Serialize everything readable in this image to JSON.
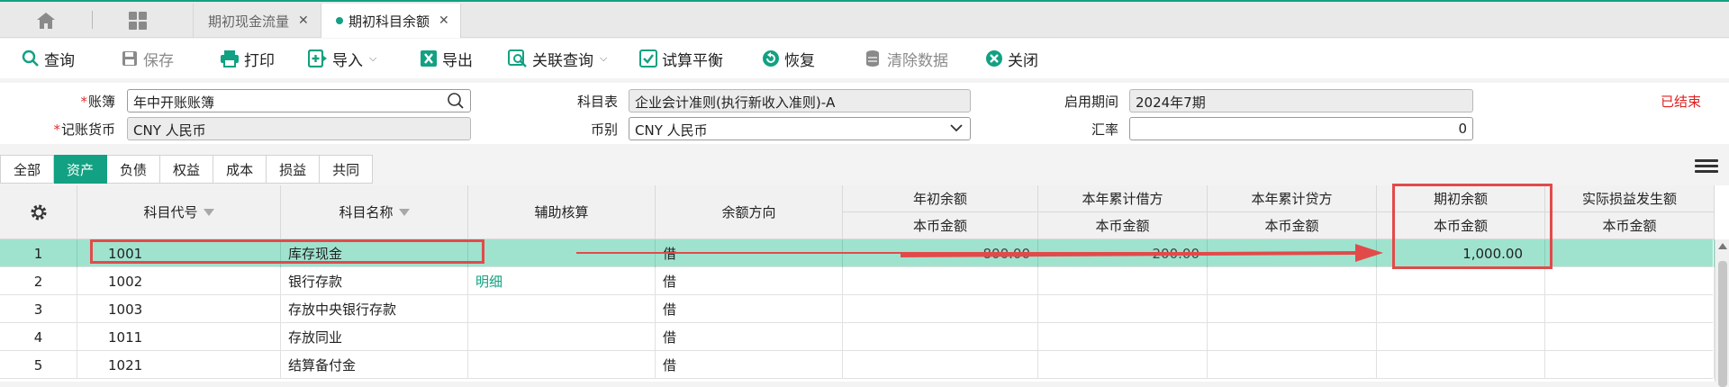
{
  "tabs": {
    "items": [
      {
        "label": "期初现金流量",
        "active": false
      },
      {
        "label": "期初科目余额",
        "active": true
      }
    ]
  },
  "toolbar": {
    "query": "查询",
    "save": "保存",
    "print": "打印",
    "import": "导入",
    "export": "导出",
    "related_query": "关联查询",
    "trial_balance": "试算平衡",
    "restore": "恢复",
    "clear_data": "清除数据",
    "close": "关闭"
  },
  "form": {
    "book_label": "账簿",
    "book_value": "年中开账账簿",
    "currency_label": "记账货币",
    "currency_value": "CNY 人民币",
    "chart_label": "科目表",
    "chart_value": "企业会计准则(执行新收入准则)-A",
    "currency_type_label": "币别",
    "currency_type_value": "CNY 人民币",
    "period_label": "启用期间",
    "period_value": "2024年7期",
    "rate_label": "汇率",
    "rate_value": "0",
    "status": "已结束"
  },
  "categories": [
    "全部",
    "资产",
    "负债",
    "权益",
    "成本",
    "损益",
    "共同"
  ],
  "active_category": "资产",
  "table": {
    "headers": {
      "code": "科目代号",
      "name": "科目名称",
      "aux": "辅助核算",
      "direction": "余额方向",
      "opening_year": "年初余额",
      "ytd_debit": "本年累计借方",
      "ytd_credit": "本年累计贷方",
      "opening_balance": "期初余额",
      "actual_pl": "实际损益发生额",
      "sub_amount": "本币金额"
    },
    "rows": [
      {
        "idx": "1",
        "code": "1001",
        "name": "库存现金",
        "aux": "",
        "direction": "借",
        "opening_year": "800.00",
        "ytd_debit": "200.00",
        "ytd_credit": "",
        "opening_balance": "1,000.00",
        "actual_pl": ""
      },
      {
        "idx": "2",
        "code": "1002",
        "name": "银行存款",
        "aux": "明细",
        "direction": "借",
        "opening_year": "",
        "ytd_debit": "",
        "ytd_credit": "",
        "opening_balance": "",
        "actual_pl": ""
      },
      {
        "idx": "3",
        "code": "1003",
        "name": "存放中央银行存款",
        "aux": "",
        "direction": "借",
        "opening_year": "",
        "ytd_debit": "",
        "ytd_credit": "",
        "opening_balance": "",
        "actual_pl": ""
      },
      {
        "idx": "4",
        "code": "1011",
        "name": "存放同业",
        "aux": "",
        "direction": "借",
        "opening_year": "",
        "ytd_debit": "",
        "ytd_credit": "",
        "opening_balance": "",
        "actual_pl": ""
      },
      {
        "idx": "5",
        "code": "1021",
        "name": "结算备付金",
        "aux": "",
        "direction": "借",
        "opening_year": "",
        "ytd_debit": "",
        "ytd_credit": "",
        "opening_balance": "",
        "actual_pl": ""
      }
    ]
  },
  "colors": {
    "accent": "#12a182",
    "selected_row": "#9fe3cf",
    "annotation": "#e24a4a",
    "status": "#e02020"
  }
}
